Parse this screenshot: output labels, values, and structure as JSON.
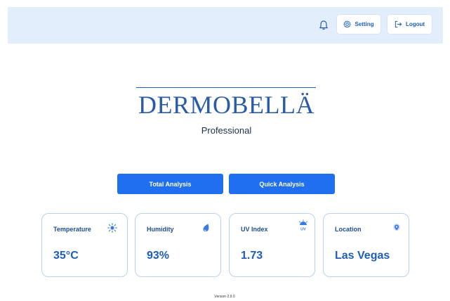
{
  "header": {
    "setting_label": "Setting",
    "logout_label": "Logout",
    "icons": {
      "notification": "bell-icon",
      "setting": "gear-icon",
      "logout": "logout-icon"
    }
  },
  "brand": {
    "logo_text": "DERMOBELLA",
    "logo_text_display": "DERMOBELLÄ",
    "subtitle": "Professional"
  },
  "actions": {
    "total_analysis": "Total Analysis",
    "quick_analysis": "Quick Analysis"
  },
  "cards": [
    {
      "label": "Temperature",
      "value": "35°C",
      "icon": "sun-icon"
    },
    {
      "label": "Humidity",
      "value": "93%",
      "icon": "drop-icon"
    },
    {
      "label": "UV Index",
      "value": "1.73",
      "icon": "uv-icon"
    },
    {
      "label": "Location",
      "value": "Las Vegas",
      "icon": "location-pin-icon"
    }
  ],
  "footer": {
    "version": "Version 2.9.0"
  },
  "colors": {
    "header_bg": "#e3eefc",
    "primary": "#1f6ff0",
    "text_accent": "#1e5db8",
    "card_border": "#b9d0f1"
  }
}
